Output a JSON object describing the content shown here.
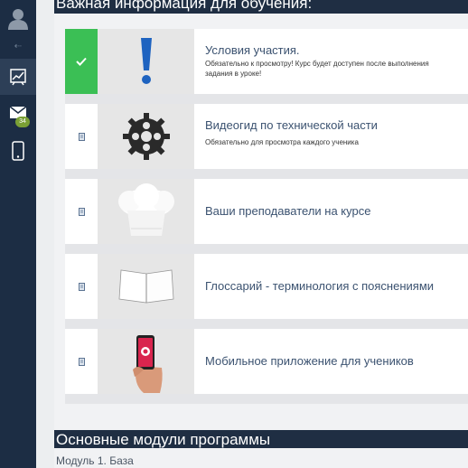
{
  "sidebar": {
    "messages_badge": "34"
  },
  "sections": {
    "important_title": "Важная информация для обучения:",
    "modules_title": "Основные модули программы"
  },
  "cards": [
    {
      "title": "Условия участия.",
      "desc": "Обязательно к просмотру! Курс будет доступен после выполнения задания в уроке!",
      "status": "completed"
    },
    {
      "title": "Видеогид по технической части",
      "desc": "Обязательно для просмотра каждого ученика",
      "status": "pending"
    },
    {
      "title": "Ваши преподаватели на курсе",
      "desc": "",
      "status": "pending"
    },
    {
      "title": "Глоссарий - терминология с пояснениями",
      "desc": "",
      "status": "pending"
    },
    {
      "title": "Мобильное приложение для учеников",
      "desc": "",
      "status": "pending"
    }
  ],
  "modules": {
    "first_label": "Модуль 1. База"
  },
  "colors": {
    "sidebar_bg": "#1c2d44",
    "header_bg": "#1f2e43",
    "completed_green": "#3bbf55",
    "title_blue": "#3b5270"
  }
}
